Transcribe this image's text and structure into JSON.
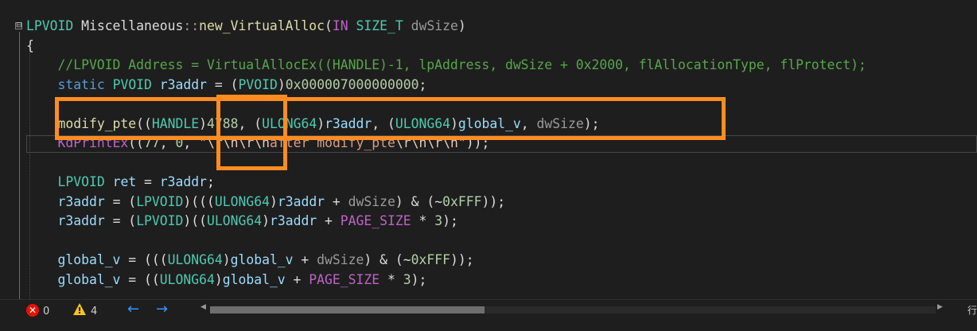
{
  "editor": {
    "fold_marker": "⊟",
    "lines": [
      {
        "tokens": [
          {
            "t": "LPVOID",
            "c": "ty"
          },
          {
            "t": " Miscellaneous",
            "c": "pl"
          },
          {
            "t": "::",
            "c": "pa"
          },
          {
            "t": "new_VirtualAlloc",
            "c": "fn"
          },
          {
            "t": "(",
            "c": "pl"
          },
          {
            "t": "IN",
            "c": "mc"
          },
          {
            "t": " ",
            "c": "pl"
          },
          {
            "t": "SIZE_T",
            "c": "ty"
          },
          {
            "t": " ",
            "c": "pl"
          },
          {
            "t": "dwSize",
            "c": "pa"
          },
          {
            "t": ")",
            "c": "pl"
          }
        ]
      },
      {
        "tokens": [
          {
            "t": "{",
            "c": "pl"
          }
        ]
      },
      {
        "tokens": [
          {
            "t": "    //LPVOID Address = VirtualAllocEx((HANDLE)-1, lpAddress, dwSize + 0x2000, flAllocationType, flProtect);",
            "c": "cm"
          }
        ]
      },
      {
        "tokens": [
          {
            "t": "    ",
            "c": "pl"
          },
          {
            "t": "static",
            "c": "kw"
          },
          {
            "t": " ",
            "c": "pl"
          },
          {
            "t": "PVOID",
            "c": "ty"
          },
          {
            "t": " ",
            "c": "pl"
          },
          {
            "t": "r3addr",
            "c": "va"
          },
          {
            "t": " = (",
            "c": "pl"
          },
          {
            "t": "PVOID",
            "c": "ty"
          },
          {
            "t": ")",
            "c": "pl"
          },
          {
            "t": "0x000007000000000",
            "c": "nu"
          },
          {
            "t": ";",
            "c": "pl"
          }
        ]
      },
      {
        "tokens": []
      },
      {
        "tokens": [
          {
            "t": "    ",
            "c": "pl"
          },
          {
            "t": "modify_pte",
            "c": "fn"
          },
          {
            "t": "((",
            "c": "pl"
          },
          {
            "t": "HANDLE",
            "c": "ty"
          },
          {
            "t": ")",
            "c": "pl"
          },
          {
            "t": "4788",
            "c": "nu"
          },
          {
            "t": ", (",
            "c": "pl"
          },
          {
            "t": "ULONG64",
            "c": "ty"
          },
          {
            "t": ")",
            "c": "pl"
          },
          {
            "t": "r3addr",
            "c": "va"
          },
          {
            "t": ", (",
            "c": "pl"
          },
          {
            "t": "ULONG64",
            "c": "ty"
          },
          {
            "t": ")",
            "c": "pl"
          },
          {
            "t": "global_v",
            "c": "va"
          },
          {
            "t": ", ",
            "c": "pl"
          },
          {
            "t": "dwSize",
            "c": "pa"
          },
          {
            "t": ");",
            "c": "pl"
          }
        ]
      },
      {
        "tokens": [
          {
            "t": "    ",
            "c": "pl"
          },
          {
            "t": "KdPrintEx",
            "c": "mc"
          },
          {
            "t": "((",
            "c": "pl"
          },
          {
            "t": "77",
            "c": "nu"
          },
          {
            "t": ", ",
            "c": "pl"
          },
          {
            "t": "0",
            "c": "nu"
          },
          {
            "t": ", ",
            "c": "pl"
          },
          {
            "t": "\"",
            "c": "st"
          },
          {
            "t": "\\r\\n\\r\\n",
            "c": "es"
          },
          {
            "t": "after modify_pte",
            "c": "st"
          },
          {
            "t": "\\r\\n\\r\\n",
            "c": "es"
          },
          {
            "t": "\"",
            "c": "st"
          },
          {
            "t": "));",
            "c": "pl"
          }
        ]
      },
      {
        "tokens": []
      },
      {
        "tokens": [
          {
            "t": "    ",
            "c": "pl"
          },
          {
            "t": "LPVOID",
            "c": "ty"
          },
          {
            "t": " ",
            "c": "pl"
          },
          {
            "t": "ret",
            "c": "va"
          },
          {
            "t": " = ",
            "c": "pl"
          },
          {
            "t": "r3addr",
            "c": "va"
          },
          {
            "t": ";",
            "c": "pl"
          }
        ]
      },
      {
        "tokens": [
          {
            "t": "    ",
            "c": "pl"
          },
          {
            "t": "r3addr",
            "c": "va"
          },
          {
            "t": " = (",
            "c": "pl"
          },
          {
            "t": "LPVOID",
            "c": "ty"
          },
          {
            "t": ")(((",
            "c": "pl"
          },
          {
            "t": "ULONG64",
            "c": "ty"
          },
          {
            "t": ")",
            "c": "pl"
          },
          {
            "t": "r3addr",
            "c": "va"
          },
          {
            "t": " + ",
            "c": "pl"
          },
          {
            "t": "dwSize",
            "c": "pa"
          },
          {
            "t": ") & (~",
            "c": "pl"
          },
          {
            "t": "0xFFF",
            "c": "nu"
          },
          {
            "t": "));",
            "c": "pl"
          }
        ]
      },
      {
        "tokens": [
          {
            "t": "    ",
            "c": "pl"
          },
          {
            "t": "r3addr",
            "c": "va"
          },
          {
            "t": " = (",
            "c": "pl"
          },
          {
            "t": "LPVOID",
            "c": "ty"
          },
          {
            "t": ")((",
            "c": "pl"
          },
          {
            "t": "ULONG64",
            "c": "ty"
          },
          {
            "t": ")",
            "c": "pl"
          },
          {
            "t": "r3addr",
            "c": "va"
          },
          {
            "t": " + ",
            "c": "pl"
          },
          {
            "t": "PAGE_SIZE",
            "c": "mc"
          },
          {
            "t": " * ",
            "c": "pl"
          },
          {
            "t": "3",
            "c": "nu"
          },
          {
            "t": ");",
            "c": "pl"
          }
        ]
      },
      {
        "tokens": []
      },
      {
        "tokens": [
          {
            "t": "    ",
            "c": "pl"
          },
          {
            "t": "global_v",
            "c": "va"
          },
          {
            "t": " = (((",
            "c": "pl"
          },
          {
            "t": "ULONG64",
            "c": "ty"
          },
          {
            "t": ")",
            "c": "pl"
          },
          {
            "t": "global_v",
            "c": "va"
          },
          {
            "t": " + ",
            "c": "pl"
          },
          {
            "t": "dwSize",
            "c": "pa"
          },
          {
            "t": ") & (~",
            "c": "pl"
          },
          {
            "t": "0xFFF",
            "c": "nu"
          },
          {
            "t": "));",
            "c": "pl"
          }
        ]
      },
      {
        "tokens": [
          {
            "t": "    ",
            "c": "pl"
          },
          {
            "t": "global_v",
            "c": "va"
          },
          {
            "t": " = ((",
            "c": "pl"
          },
          {
            "t": "ULONG64",
            "c": "ty"
          },
          {
            "t": ")",
            "c": "pl"
          },
          {
            "t": "global_v",
            "c": "va"
          },
          {
            "t": " + ",
            "c": "pl"
          },
          {
            "t": "PAGE_SIZE",
            "c": "mc"
          },
          {
            "t": " * ",
            "c": "pl"
          },
          {
            "t": "3",
            "c": "nu"
          },
          {
            "t": ");",
            "c": "pl"
          }
        ]
      }
    ]
  },
  "status": {
    "errors": "0",
    "warnings": "4",
    "nav_back": "←",
    "nav_forward": "→",
    "scroll_left": "◀",
    "scroll_right": "▶",
    "row_label": "行"
  },
  "colors": {
    "highlight_box": "#ff8c21",
    "error": "#e51400",
    "warning": "#f5c518"
  }
}
